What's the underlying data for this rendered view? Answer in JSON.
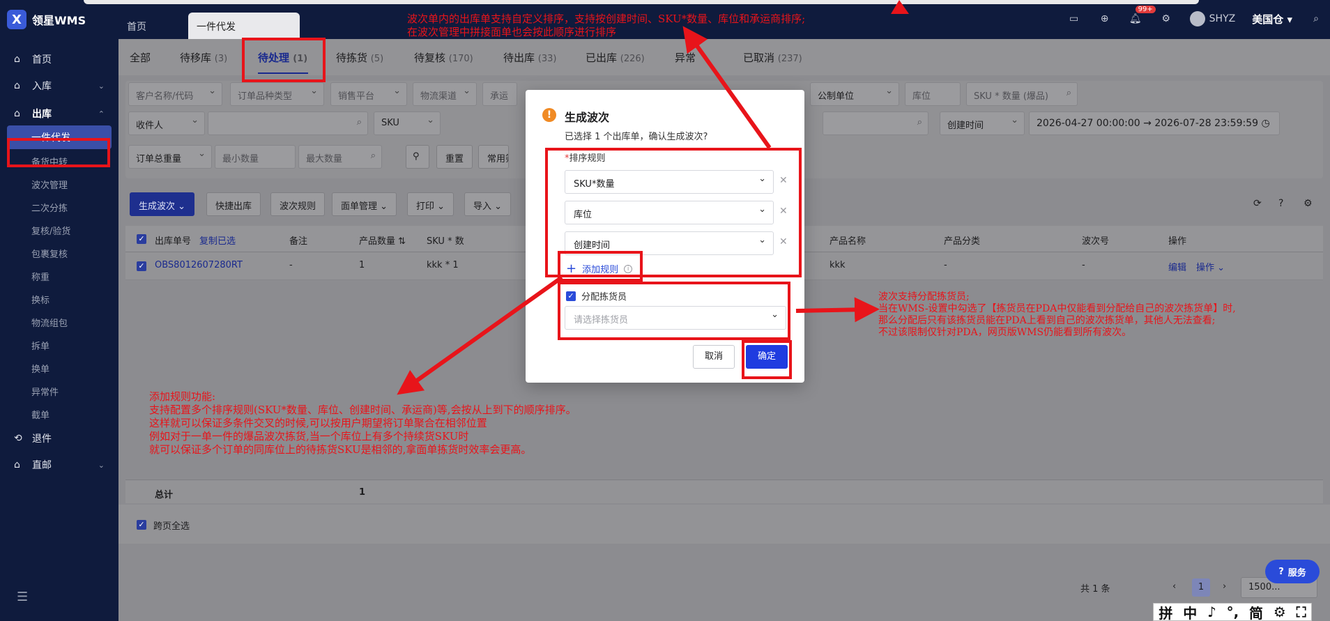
{
  "app": {
    "logo_glyph": "X",
    "name": "领星WMS"
  },
  "top_tabs": {
    "home": "首页",
    "active": "一件代发"
  },
  "top_right": {
    "badge": "99+",
    "user": "SHYZ",
    "warehouse": "美国仓"
  },
  "sidebar": {
    "items": [
      {
        "label": "首页",
        "icon": "home-icon"
      },
      {
        "label": "入库",
        "icon": "inbound-icon"
      },
      {
        "label": "出库",
        "icon": "outbound-icon"
      },
      {
        "label": "一件代发"
      },
      {
        "label": "备货中转"
      },
      {
        "label": "波次管理"
      },
      {
        "label": "二次分拣"
      },
      {
        "label": "复核/验货"
      },
      {
        "label": "包裹复核"
      },
      {
        "label": "称重"
      },
      {
        "label": "换标"
      },
      {
        "label": "物流组包"
      },
      {
        "label": "拆单"
      },
      {
        "label": "换单"
      },
      {
        "label": "异常件"
      },
      {
        "label": "截单"
      },
      {
        "label": "退件",
        "icon": "return-icon"
      },
      {
        "label": "直邮",
        "icon": "direct-mail-icon"
      }
    ]
  },
  "status_tabs": [
    {
      "label": "全部",
      "count": ""
    },
    {
      "label": "待移库",
      "count": "(3)"
    },
    {
      "label": "待处理",
      "count": "(1)"
    },
    {
      "label": "待拣货",
      "count": "(5)"
    },
    {
      "label": "待复核",
      "count": "(170)"
    },
    {
      "label": "待出库",
      "count": "(33)"
    },
    {
      "label": "已出库",
      "count": "(226)"
    },
    {
      "label": "异常",
      "count": ""
    },
    {
      "label": "已取消",
      "count": "(237)"
    }
  ],
  "filters": {
    "customer": "客户名称/代码",
    "order_type": "订单品种类型",
    "platform": "销售平台",
    "channel": "物流渠道",
    "carrier": "承运",
    "unit": "公制单位",
    "location": "库位",
    "sku_qty": "SKU * 数量 (爆品)",
    "recipient": "收件人",
    "sku": "SKU",
    "created_time": "创建时间",
    "date_from": "2026-04-27 00:00:00",
    "date_to": "2026-07-28 23:59:59",
    "weight": "订单总重量",
    "min_qty": "最小数量",
    "max_qty": "最大数量",
    "reset": "重置",
    "common": "常用筛"
  },
  "toolbar": {
    "generate_wave": "生成波次",
    "quick_out": "快捷出库",
    "wave_rules": "波次规则",
    "label_mgmt": "面单管理",
    "print": "打印",
    "import": "导入"
  },
  "table": {
    "headers": {
      "order_no": "出库单号",
      "copy": "复制已选",
      "note": "备注",
      "qty": "产品数量",
      "sku": "SKU * 数",
      "product_name": "产品名称",
      "category": "产品分类",
      "wave_no": "波次号",
      "ops": "操作"
    },
    "row": {
      "order_no": "OBS8012607280RT",
      "note": "-",
      "qty": "1",
      "sku": "kkk * 1",
      "product_name": "kkk",
      "category": "-",
      "wave_no": "-",
      "edit": "编辑",
      "ops": "操作"
    },
    "total_label": "总计",
    "total_qty": "1"
  },
  "footer": {
    "cross_page": "跨页全选",
    "count": "共 1 条",
    "page": "1",
    "page_size": "1500..."
  },
  "modal": {
    "title": "生成波次",
    "desc": "已选择 1 个出库单，确认生成波次?",
    "rule_label": "排序规则",
    "rules": [
      "SKU*数量",
      "库位",
      "创建时间"
    ],
    "add_rule": "添加规则",
    "assign_picker": "分配拣货员",
    "picker_placeholder": "请选择拣货员",
    "cancel": "取消",
    "confirm": "确定"
  },
  "annotations": {
    "top": [
      "波次单内的出库单支持自定义排序，支持按创建时间、SKU*数量、库位和承运商排序;",
      "在波次管理中拼接面单也会按此顺序进行排序"
    ],
    "left": [
      "添加规则功能:",
      "支持配置多个排序规则(SKU*数量、库位、创建时间、承运商)等,会按从上到下的顺序排序。",
      "这样就可以保证多条件交叉的时候,可以按用户期望将订单聚合在相邻位置",
      "例如对于一单一件的爆品波次拣货,当一个库位上有多个持续货SKU时",
      "就可以保证多个订单的同库位上的待拣货SKU是相邻的,拿面单拣货时效率会更高。"
    ],
    "right": [
      "波次支持分配拣货员;",
      "当在WMS-设置中勾选了【拣货员在PDA中仅能看到分配给自己的波次拣货单】时,",
      "那么分配后只有该拣货员能在PDA上看到自己的波次拣货单，其他人无法查看;",
      "不过该限制仅针对PDA，网页版WMS仍能看到所有波次。"
    ]
  },
  "service_button": "服务",
  "ime": [
    "拼",
    "中",
    "♪",
    "°,",
    "简",
    "⚙",
    "⛶"
  ],
  "colors": {
    "accent": "#1f3ce0",
    "annotation": "#e8141a",
    "nav": "#0f1b3d"
  }
}
